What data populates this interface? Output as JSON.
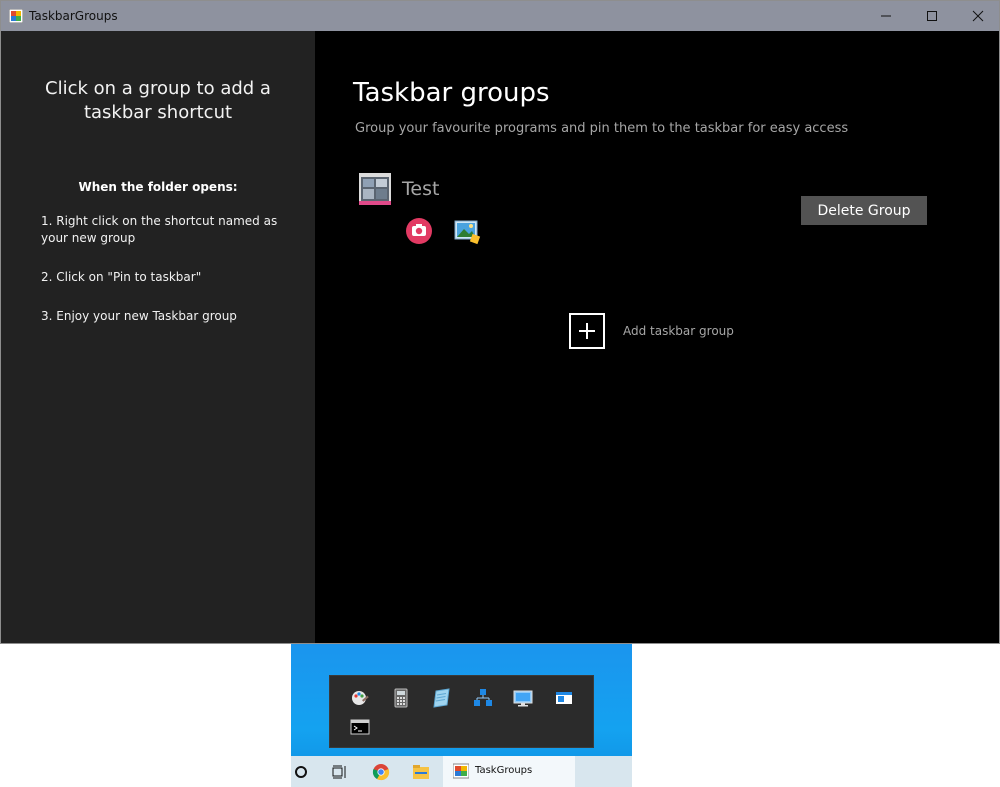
{
  "window": {
    "title": "TaskbarGroups"
  },
  "sidebar": {
    "heading": "Click on a group to add a taskbar shortcut",
    "steps_heading": "When the folder opens:",
    "steps": [
      "1. Right click on the shortcut named as your new group",
      "2. Click on \"Pin to taskbar\"",
      "3. Enjoy your new Taskbar group"
    ]
  },
  "main": {
    "title": "Taskbar groups",
    "subtitle": "Group your favourite programs and pin them to the taskbar for easy access",
    "groups": [
      {
        "name": "Test",
        "icon": "group-thumbnail-icon",
        "shortcuts": [
          "camera-app-icon",
          "photos-app-icon"
        ]
      }
    ],
    "delete_label": "Delete Group",
    "add_label": "Add taskbar group"
  },
  "preview": {
    "popup_icons": [
      "paint-icon",
      "calculator-icon",
      "notepad-icon",
      "network-icon",
      "remote-desktop-icon",
      "window-icon",
      "command-prompt-icon"
    ],
    "taskbar": {
      "items": [
        "cortana-circle-icon",
        "task-view-icon",
        "chrome-icon",
        "file-explorer-icon"
      ],
      "active_label": "TaskGroups"
    }
  },
  "colors": {
    "sidebar_bg": "#222222",
    "main_bg": "#000000",
    "titlebar_bg": "#8e929f",
    "button_bg": "#535353",
    "muted_text": "#a6a6a6",
    "desktop_blue": "#1b95ee"
  }
}
